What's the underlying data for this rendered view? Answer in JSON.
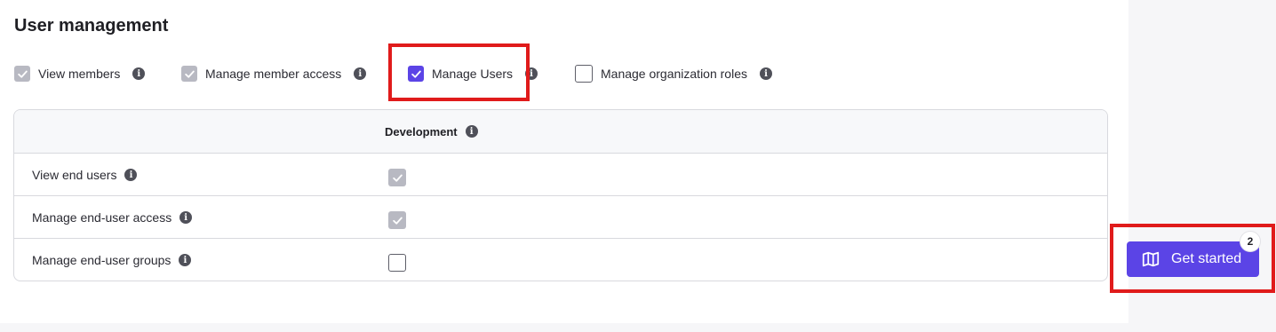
{
  "page": {
    "title": "User management"
  },
  "permissions": [
    {
      "label": "View members",
      "state": "checked-disabled"
    },
    {
      "label": "Manage member access",
      "state": "checked-disabled"
    },
    {
      "label": "Manage Users",
      "state": "checked"
    },
    {
      "label": "Manage organization roles",
      "state": "unchecked"
    }
  ],
  "table": {
    "column_header": "Development",
    "rows": [
      {
        "label": "View end users",
        "state": "checked-disabled"
      },
      {
        "label": "Manage end-user access",
        "state": "checked-disabled"
      },
      {
        "label": "Manage end-user groups",
        "state": "unchecked"
      }
    ]
  },
  "cta": {
    "label": "Get started",
    "badge": "2",
    "icon": "map-icon"
  },
  "icons": {
    "info": "info-icon",
    "check": "check-icon"
  },
  "colors": {
    "accent": "#5b44e6",
    "disabled_check": "#b8b9c2",
    "highlight": "#e01b1b"
  }
}
